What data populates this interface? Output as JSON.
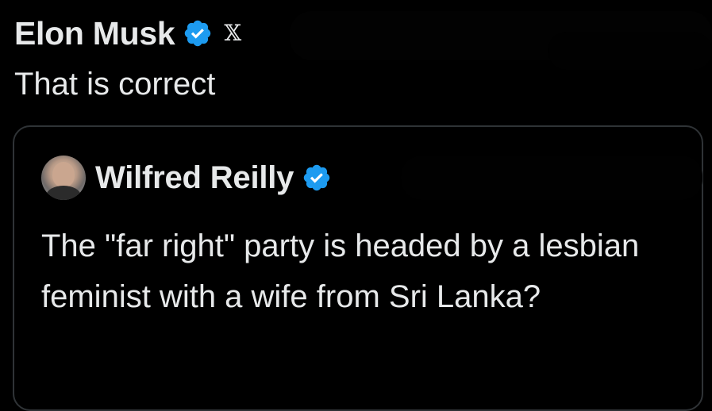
{
  "post": {
    "author_name": "Elon Musk",
    "verified_icon": "verified-badge-icon",
    "affiliation_icon": "x-logo-icon",
    "affiliation_glyph": "𝕏",
    "text": "That is correct"
  },
  "quoted_post": {
    "author_name": "Wilfred Reilly",
    "verified_icon": "verified-badge-icon",
    "text": "The \"far right\" party is headed by a lesbian feminist with a wife from Sri Lanka?"
  },
  "colors": {
    "background": "#000000",
    "text": "#e7e9ea",
    "verified_blue": "#1d9bf0",
    "card_border": "#2f3336"
  }
}
